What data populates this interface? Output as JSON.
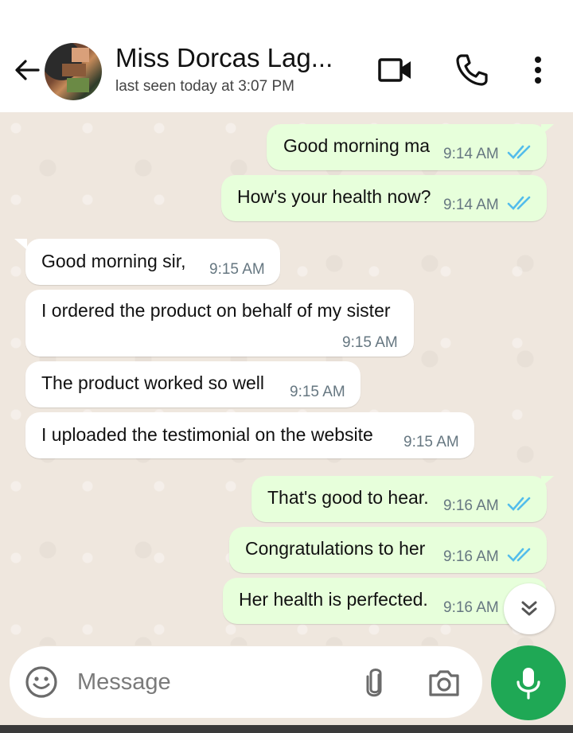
{
  "header": {
    "contact_name": "Miss Dorcas Lag...",
    "status": "last seen today at 3:07 PM"
  },
  "messages": [
    {
      "dir": "out",
      "text": "Good morning ma",
      "time": "9:14 AM",
      "read": true
    },
    {
      "dir": "out",
      "text": "How's your health now?",
      "time": "9:14 AM",
      "read": true
    },
    {
      "dir": "in",
      "text": "Good morning sir,",
      "time": "9:15 AM"
    },
    {
      "dir": "in",
      "text": "I ordered the product on behalf of my sister",
      "time": "9:15 AM"
    },
    {
      "dir": "in",
      "text": "The product worked so well",
      "time": "9:15 AM"
    },
    {
      "dir": "in",
      "text": "I uploaded the testimonial on the website",
      "time": "9:15 AM"
    },
    {
      "dir": "out",
      "text": "That's good to hear.",
      "time": "9:16 AM",
      "read": true
    },
    {
      "dir": "out",
      "text": "Congratulations to her",
      "time": "9:16 AM",
      "read": true
    },
    {
      "dir": "out",
      "text": "Her health is perfected.",
      "time": "9:16 AM",
      "read": true
    }
  ],
  "composer": {
    "placeholder": "Message"
  },
  "icons": {
    "back": "arrow-left-icon",
    "video": "video-camera-icon",
    "call": "phone-icon",
    "menu": "more-vertical-icon",
    "emoji": "emoji-icon",
    "attach": "paperclip-icon",
    "camera": "camera-icon",
    "mic": "microphone-icon",
    "scroll": "double-chevron-down-icon",
    "read": "double-check-icon"
  },
  "colors": {
    "outgoing_bubble": "#e7ffdb",
    "incoming_bubble": "#ffffff",
    "chat_background": "#efe7de",
    "read_tick": "#53bdeb",
    "mic_button": "#1fa855"
  }
}
